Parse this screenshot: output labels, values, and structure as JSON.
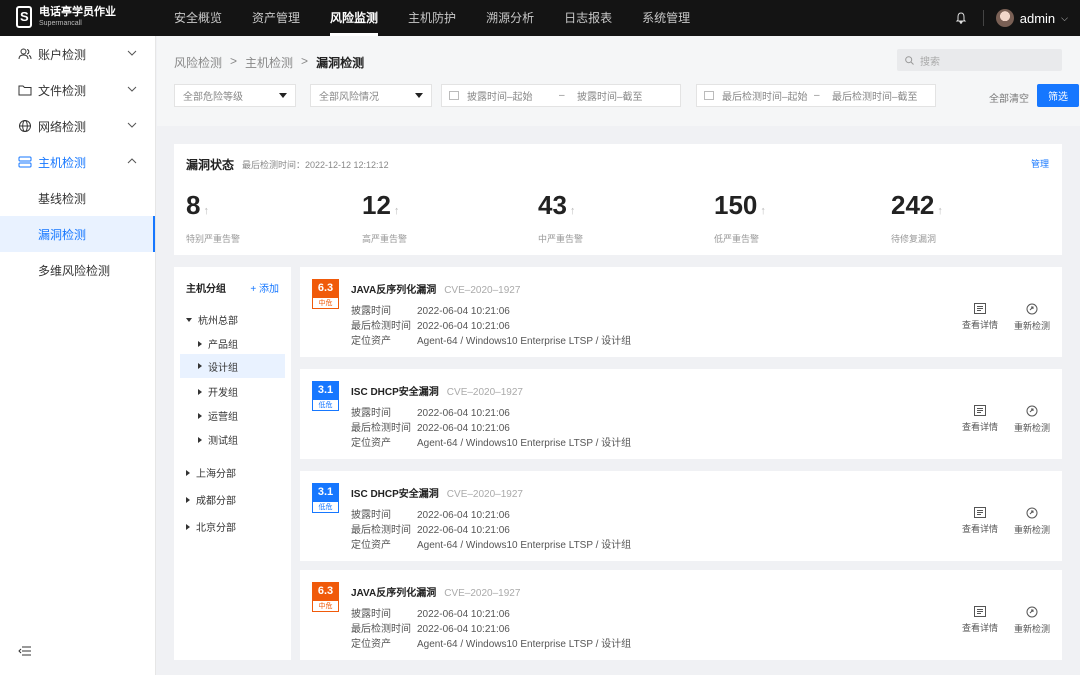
{
  "app": {
    "logo_title": "电话亭学员作业",
    "logo_sub": "Supermancall",
    "user": "admin"
  },
  "topnav": [
    "安全概览",
    "资产管理",
    "风险监测",
    "主机防护",
    "溯源分析",
    "日志报表",
    "系统管理"
  ],
  "topnav_active": 2,
  "sidebar": {
    "items": [
      "账户检测",
      "文件检测",
      "网络检测",
      "主机检测"
    ],
    "subitems": [
      "基线检测",
      "漏洞检测",
      "多维风险检测"
    ]
  },
  "breadcrumb": [
    "风险检测",
    "主机检测",
    "漏洞检测"
  ],
  "search": {
    "placeholder": "搜索"
  },
  "filters": {
    "danger_level": "全部危险等级",
    "risk_status": "全部风险情况",
    "expose_start": "披露时间–起始",
    "expose_end": "披露时间–截至",
    "check_start": "最后检测时间–起始",
    "check_end": "最后检测时间–截至",
    "range_sep": "–",
    "clear": "全部清空",
    "submit": "筛选"
  },
  "status": {
    "title": "漏洞状态",
    "last_check": "最后检测时间：2022-12-12 12:12:12",
    "manage": "管理",
    "arrow": "↑",
    "stats": [
      {
        "value": "8",
        "label": "特别严重告警"
      },
      {
        "value": "12",
        "label": "高严重告警"
      },
      {
        "value": "43",
        "label": "中严重告警"
      },
      {
        "value": "150",
        "label": "低严重告警"
      },
      {
        "value": "242",
        "label": "待修复漏洞"
      }
    ]
  },
  "tree": {
    "head": "主机分组",
    "add": "+ 添加",
    "root": "杭州总部",
    "groups": [
      "产品组",
      "设计组",
      "开发组",
      "运营组",
      "测试组"
    ],
    "branches": [
      "上海分部",
      "成都分部",
      "北京分部"
    ]
  },
  "labels": {
    "expose": "披露时间",
    "last_check": "最后检测时间",
    "asset": "定位资产",
    "detail": "查看详情",
    "recheck": "重新检测"
  },
  "vulns": [
    {
      "score": "6.3",
      "level": "中危",
      "title": "JAVA反序列化漏洞",
      "cve": "CVE–2020–1927",
      "expose": "2022-06-04 10:21:06",
      "check": "2022-06-04 10:21:06",
      "asset": "Agent-64 / Windows10 Enterprise LTSP / 设计组"
    },
    {
      "score": "3.1",
      "level": "低危",
      "title": "ISC DHCP安全漏洞",
      "cve": "CVE–2020–1927",
      "expose": "2022-06-04 10:21:06",
      "check": "2022-06-04 10:21:06",
      "asset": "Agent-64 / Windows10 Enterprise LTSP / 设计组"
    },
    {
      "score": "3.1",
      "level": "低危",
      "title": "ISC DHCP安全漏洞",
      "cve": "CVE–2020–1927",
      "expose": "2022-06-04 10:21:06",
      "check": "2022-06-04 10:21:06",
      "asset": "Agent-64 / Windows10 Enterprise LTSP / 设计组"
    },
    {
      "score": "6.3",
      "level": "中危",
      "title": "JAVA反序列化漏洞",
      "cve": "CVE–2020–1927",
      "expose": "2022-06-04 10:21:06",
      "check": "2022-06-04 10:21:06",
      "asset": "Agent-64 / Windows10 Enterprise LTSP / 设计组"
    }
  ],
  "colors": {
    "accent": "#1677ff",
    "medium": "#f05a0a",
    "topbar": "#141414"
  }
}
